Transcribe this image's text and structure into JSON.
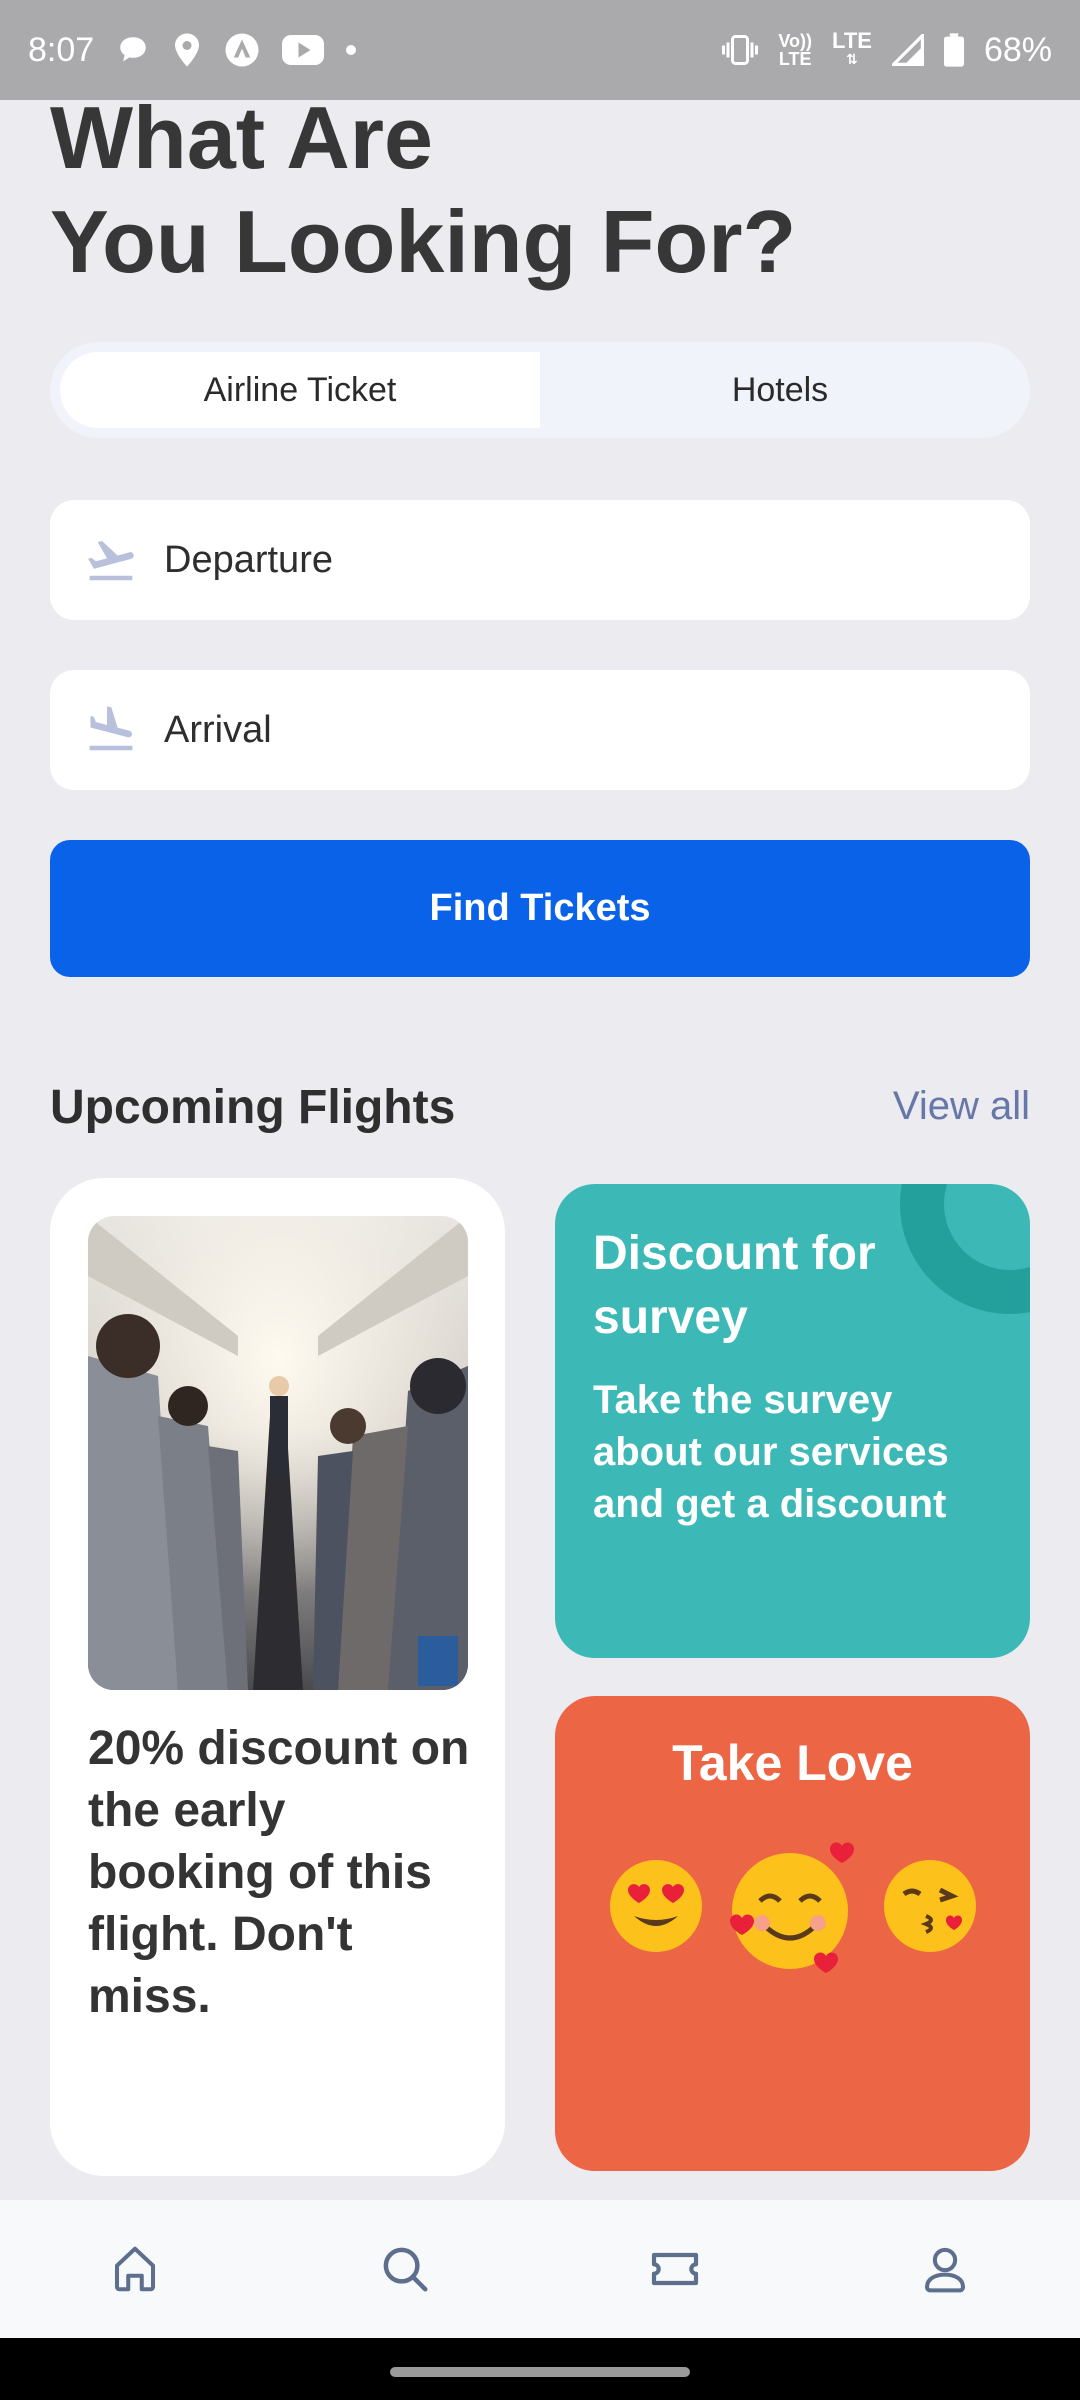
{
  "status_bar": {
    "time": "8:07",
    "network_top": "Vo))",
    "network_bottom": "LTE",
    "lte_label": "LTE",
    "battery": "68%"
  },
  "headline": {
    "line1": "What Are",
    "line2": "You Looking For?"
  },
  "tabs": [
    {
      "label": "Airline Ticket",
      "active": true
    },
    {
      "label": "Hotels",
      "active": false
    }
  ],
  "departure": {
    "label": "Departure"
  },
  "arrival": {
    "label": "Arrival"
  },
  "find_button": {
    "label": "Find Tickets"
  },
  "upcoming": {
    "title": "Upcoming Flights",
    "view_all": "View all"
  },
  "promo_card": {
    "text": "20% discount on the early booking of this flight. Don't miss."
  },
  "survey_card": {
    "title": "Discount for survey",
    "description": "Take the survey about our services and get a discount",
    "color": "#3cb8b6"
  },
  "love_card": {
    "title": "Take Love",
    "emojis": [
      "😍",
      "🥰",
      "😘"
    ],
    "color": "#ec6545"
  },
  "bottom_nav": [
    {
      "icon": "home-icon"
    },
    {
      "icon": "search-icon"
    },
    {
      "icon": "ticket-icon"
    },
    {
      "icon": "profile-icon"
    }
  ],
  "colors": {
    "primary": "#0962e8",
    "link": "#6677a8",
    "background": "#ebebf0"
  }
}
